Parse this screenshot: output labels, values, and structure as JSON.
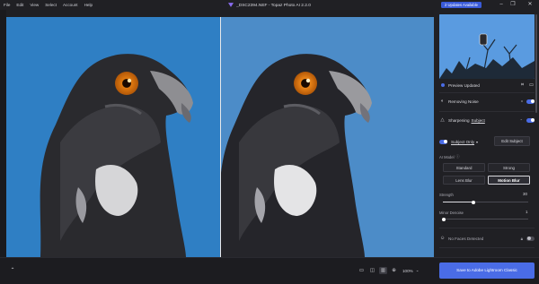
{
  "menu": [
    "File",
    "Edit",
    "View",
    "Select",
    "Account",
    "Help"
  ],
  "window": {
    "title": "_DSC2394.NEF - Topaz Photo AI 2.2.0"
  },
  "updates_badge": "2 Updates Available",
  "panel": {
    "preview_status": "Preview Updated",
    "removing_noise": {
      "label": "Removing Noise",
      "enabled": true
    },
    "sharpening": {
      "label_prefix": "Sharpening",
      "label_link": "Subject",
      "enabled": true
    },
    "subject_only": {
      "label": "Subject Only",
      "enabled": true
    },
    "edit_subject": "Edit Subject",
    "ai_model": {
      "label": "AI Model",
      "options": [
        "Standard",
        "Strong",
        "Lens Blur",
        "Motion Blur"
      ],
      "selected": "Motion Blur"
    },
    "strength": {
      "label": "Strength",
      "value": 30,
      "value_text": "30"
    },
    "minor_denoise": {
      "label": "Minor Denoise",
      "value": 1,
      "value_text": "1"
    },
    "no_faces": {
      "label": "No Faces Detected",
      "enabled": false
    }
  },
  "bottom": {
    "zoom": "100%",
    "save_button": "Save to Adobe Lightroom Classic"
  },
  "colors": {
    "accent": "#4a6ce6",
    "sky_left": "#2f7fc4",
    "sky_right": "#4c8cc8"
  }
}
